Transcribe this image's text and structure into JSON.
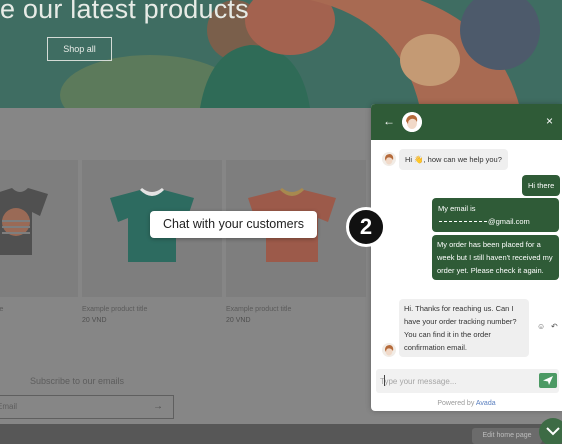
{
  "store": {
    "hero_title": "e our latest products",
    "shop_button": "Shop all",
    "products": [
      {
        "title": "le",
        "price": ""
      },
      {
        "title": "Example product title",
        "price": "20 VND"
      },
      {
        "title": "Example product title",
        "price": "20 VND"
      }
    ],
    "subscribe_title": "Subscribe to our emails",
    "email_placeholder": "Email",
    "email_arrow": "→",
    "edit_home": "Edit home page"
  },
  "chat": {
    "header": {
      "back_icon": "arrow-left-icon",
      "close_icon": "close-icon",
      "back_glyph": "←",
      "close_glyph": "×"
    },
    "messages": [
      {
        "from": "bot",
        "text": "Hi 👋, how can we help you?"
      },
      {
        "from": "user",
        "text": "Hi there"
      },
      {
        "from": "user",
        "text_before": "My email is",
        "text_after": "@gmail.com"
      },
      {
        "from": "user",
        "text": "My order has been placed for a week but I still haven't received my order yet. Please check it again."
      },
      {
        "from": "bot",
        "text": "Hi. Thanks for reaching us. Can I have your order tracking number? You can find it in the order confirmation email."
      }
    ],
    "reaction_glyph": "☺",
    "reply_glyph": "↶",
    "input_placeholder": "Type your message...",
    "powered_prefix": "Powered by",
    "powered_brand": "Avada"
  },
  "overlay": {
    "tooltip_text": "Chat with your customers",
    "step_number": "2"
  },
  "colors": {
    "chat_accent": "#2f5b37",
    "send_button": "#4c9a64",
    "bot_bubble": "#efefef",
    "hero_bg": "#3f6d62"
  }
}
